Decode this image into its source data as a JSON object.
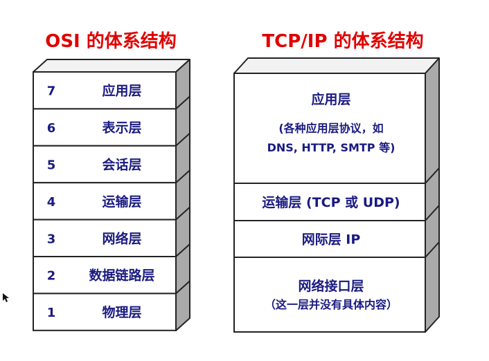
{
  "osi": {
    "title": "OSI 的体系结构",
    "layers": [
      {
        "num": "7",
        "name": "应用层"
      },
      {
        "num": "6",
        "name": "表示层"
      },
      {
        "num": "5",
        "name": "会话层"
      },
      {
        "num": "4",
        "name": "运输层"
      },
      {
        "num": "3",
        "name": "网络层"
      },
      {
        "num": "2",
        "name": "数据链路层"
      },
      {
        "num": "1",
        "name": "物理层"
      }
    ]
  },
  "tcpip": {
    "title": "TCP/IP 的体系结构",
    "layers": [
      {
        "name": "应用层",
        "details": [
          "(各种应用层协议，如",
          "DNS, HTTP, SMTP 等)"
        ]
      },
      {
        "name": "运输层 (TCP 或 UDP)",
        "details": []
      },
      {
        "name": "网际层 IP",
        "details": []
      },
      {
        "name": "网络接口层",
        "details": [
          "（这一层并没有具体内容）"
        ]
      }
    ]
  },
  "colors": {
    "title": "#e00000",
    "text": "#1a1a80",
    "side": "#aaaaaa",
    "top": "#f2f2f2",
    "border": "#222222"
  },
  "icons": [
    "mouse-cursor-icon"
  ]
}
